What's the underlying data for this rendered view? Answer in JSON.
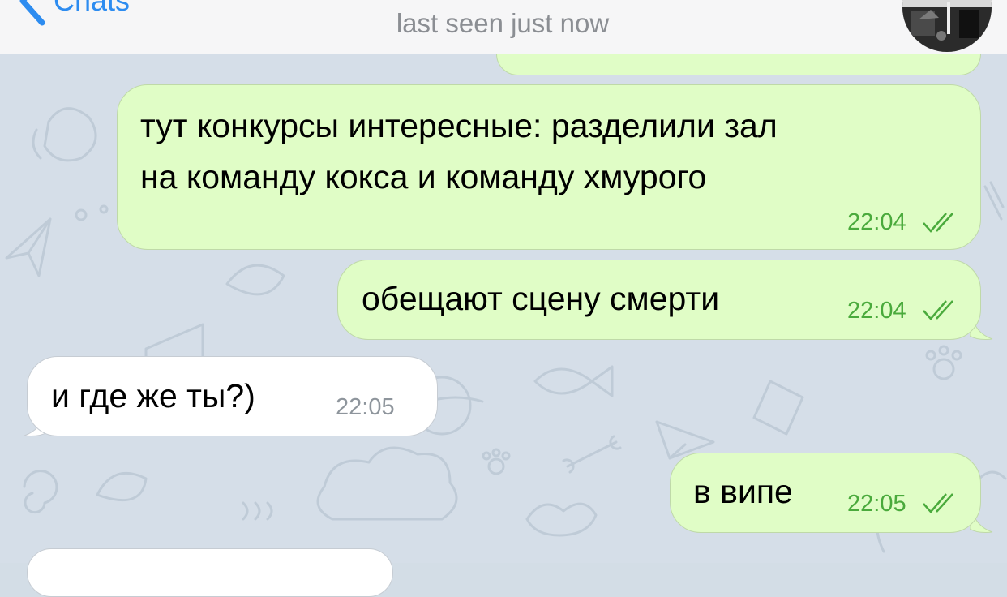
{
  "header": {
    "back_label": "Chats",
    "title": "",
    "subtitle": "last seen just now"
  },
  "messages": [
    {
      "direction": "out",
      "text_lines": [
        "тут конкурсы интересные: разделили зал",
        "на команду кокса и команду хмурого"
      ],
      "time": "22:04",
      "status": "read"
    },
    {
      "direction": "out",
      "text_lines": [
        "обещают сцену смерти"
      ],
      "time": "22:04",
      "status": "read"
    },
    {
      "direction": "in",
      "text_lines": [
        "и где же ты?)"
      ],
      "time": "22:05"
    },
    {
      "direction": "out",
      "text_lines": [
        "в випе"
      ],
      "time": "22:05",
      "status": "read"
    }
  ],
  "colors": {
    "accent": "#2d8cf0",
    "outgoing_bubble": "#e0fdc6",
    "incoming_bubble": "#ffffff",
    "outgoing_time": "#4aaa3c",
    "incoming_time": "#8e959c",
    "chat_background": "#d5dee8"
  },
  "icons": {
    "back": "chevron-left-icon",
    "read_status": "double-check-icon"
  }
}
